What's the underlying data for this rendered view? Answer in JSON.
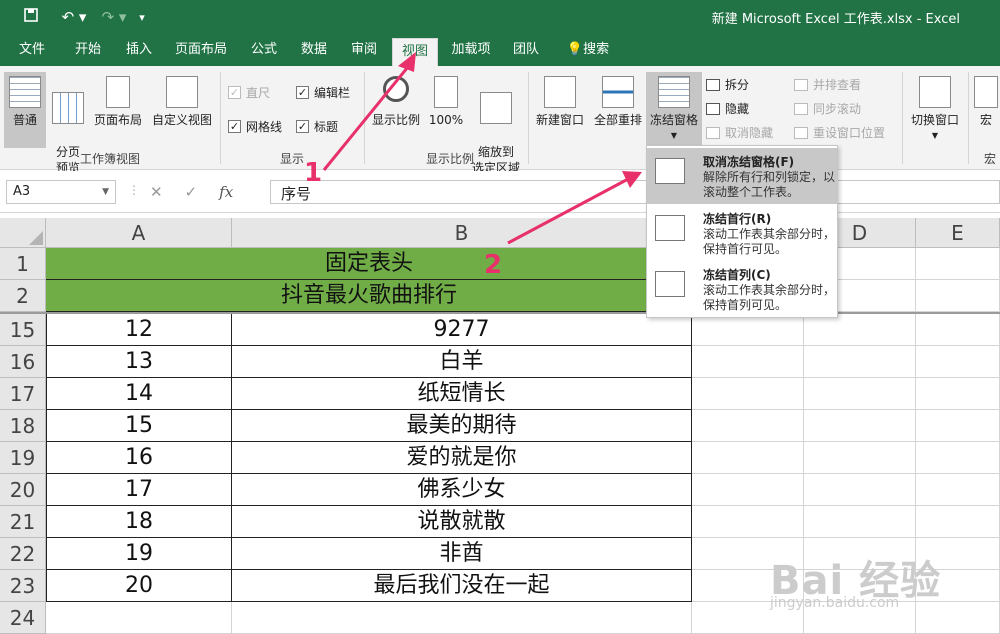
{
  "window": {
    "title": "新建 Microsoft Excel 工作表.xlsx  -  Excel"
  },
  "qat": {
    "save_icon": "save-icon",
    "undo_icon": "undo-icon",
    "redo_icon": "redo-icon",
    "customize_icon": "customize-qat-icon"
  },
  "tabs": [
    {
      "label": "文件"
    },
    {
      "label": "开始"
    },
    {
      "label": "插入"
    },
    {
      "label": "页面布局"
    },
    {
      "label": "公式"
    },
    {
      "label": "数据"
    },
    {
      "label": "审阅"
    },
    {
      "label": "视图"
    },
    {
      "label": "加载项"
    },
    {
      "label": "团队"
    },
    {
      "label": "搜索"
    }
  ],
  "ribbon": {
    "workbook_views": {
      "normal": "普通",
      "page_break": "分页\n预览",
      "page_layout": "页面布局",
      "custom": "自定义视图",
      "group": "工作簿视图"
    },
    "show": {
      "ruler": "直尺",
      "formula_bar": "编辑栏",
      "gridlines": "网格线",
      "headings": "标题",
      "group": "显示"
    },
    "zoom": {
      "zoom": "显示比例",
      "hundred": "100%",
      "to_selection": "缩放到\n选定区域",
      "group": "显示比例"
    },
    "window": {
      "new_window": "新建窗口",
      "arrange_all": "全部重排",
      "freeze_panes": "冻结窗格",
      "split": "拆分",
      "hide": "隐藏",
      "unhide": "取消隐藏",
      "side_by_side": "并排查看",
      "sync_scroll": "同步滚动",
      "reset_pos": "重设窗口位置",
      "switch": "切换窗口",
      "macros": "宏",
      "macros_group": "宏"
    }
  },
  "formula_bar": {
    "name_box": "A3",
    "fx": "fx",
    "content": "序号"
  },
  "columns": [
    "A",
    "B",
    "C",
    "D",
    "E"
  ],
  "header_rows": [
    {
      "row": "1",
      "text": "固定表头"
    },
    {
      "row": "2",
      "text": "抖音最火歌曲排行"
    }
  ],
  "rows": [
    {
      "row": "15",
      "a": "12",
      "b": "9277"
    },
    {
      "row": "16",
      "a": "13",
      "b": "白羊"
    },
    {
      "row": "17",
      "a": "14",
      "b": "纸短情长"
    },
    {
      "row": "18",
      "a": "15",
      "b": "最美的期待"
    },
    {
      "row": "19",
      "a": "16",
      "b": "爱的就是你"
    },
    {
      "row": "20",
      "a": "17",
      "b": "佛系少女"
    },
    {
      "row": "21",
      "a": "18",
      "b": "说散就散"
    },
    {
      "row": "22",
      "a": "19",
      "b": "非酋"
    },
    {
      "row": "23",
      "a": "20",
      "b": "最后我们没在一起"
    },
    {
      "row": "24",
      "a": "",
      "b": ""
    }
  ],
  "freeze_menu": [
    {
      "title": "取消冻结窗格(F)",
      "desc": "解除所有行和列锁定，以滚动整个工作表。"
    },
    {
      "title": "冻结首行(R)",
      "desc": "滚动工作表其余部分时，保持首行可见。"
    },
    {
      "title": "冻结首列(C)",
      "desc": "滚动工作表其余部分时，保持首列可见。"
    }
  ],
  "callouts": {
    "one": "1",
    "two": "2"
  },
  "watermark": {
    "main": "Bai 经验",
    "sub": "jingyan.baidu.com"
  },
  "colors": {
    "excel_green": "#217346",
    "header_fill": "#70ad47",
    "callout": "#e8306a"
  }
}
